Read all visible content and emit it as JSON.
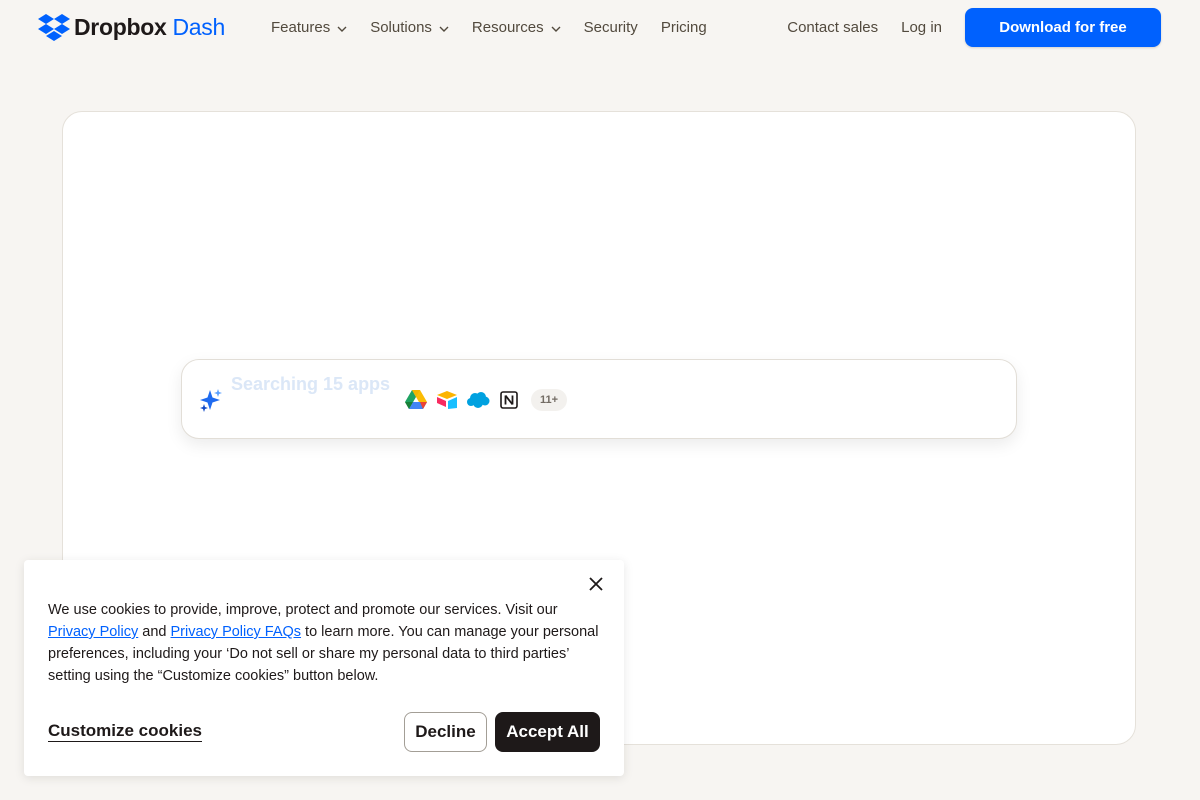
{
  "header": {
    "logo_brand": "Dropbox",
    "logo_product": "Dash",
    "nav": [
      {
        "label": "Features",
        "has_dropdown": true
      },
      {
        "label": "Solutions",
        "has_dropdown": true
      },
      {
        "label": "Resources",
        "has_dropdown": true
      },
      {
        "label": "Security",
        "has_dropdown": false
      },
      {
        "label": "Pricing",
        "has_dropdown": false
      }
    ],
    "contact_sales": "Contact sales",
    "login": "Log in",
    "download_label": "Download for free"
  },
  "hero": {
    "search_text": "Searching 15 apps",
    "apps": [
      {
        "name": "google-drive-icon"
      },
      {
        "name": "airtable-icon"
      },
      {
        "name": "salesforce-icon"
      },
      {
        "name": "notion-icon"
      }
    ],
    "more_badge": "11+"
  },
  "cookie": {
    "text_1": "We use cookies to provide, improve, protect and promote our services. Visit our ",
    "privacy_policy": "Privacy Policy",
    "text_2": " and ",
    "privacy_faqs": "Privacy Policy FAQs",
    "text_3": " to learn more. You can manage your personal preferences, including your ‘Do not sell or share my personal data to third parties’ setting using the “Customize cookies” button below.",
    "customize_label": "Customize cookies",
    "decline_label": "Decline",
    "accept_label": "Accept All"
  },
  "colors": {
    "brand_blue": "#0061fe",
    "page_bg": "#f7f5f2",
    "dark": "#1e1919"
  }
}
